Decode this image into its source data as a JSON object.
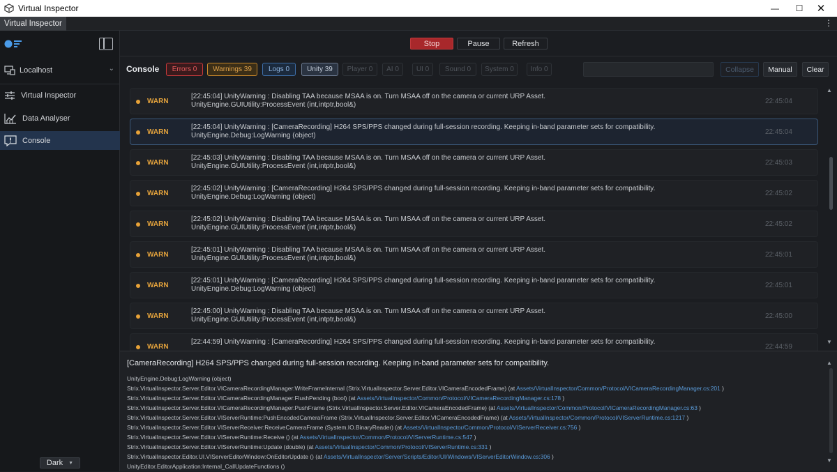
{
  "window": {
    "title": "Virtual Inspector"
  },
  "tab": {
    "label": "Virtual Inspector"
  },
  "sidebar": {
    "host": "Localhost",
    "items": [
      {
        "label": "Virtual Inspector",
        "icon": "sliders-icon"
      },
      {
        "label": "Data Analyser",
        "icon": "line-chart-icon"
      },
      {
        "label": "Console",
        "icon": "console-alert-icon",
        "active": true
      }
    ],
    "theme": "Dark"
  },
  "toolbar": {
    "stop": "Stop",
    "pause": "Pause",
    "refresh": "Refresh"
  },
  "console": {
    "title": "Console",
    "filters": [
      {
        "label": "Errors 0",
        "state": "errors"
      },
      {
        "label": "Warnings 39",
        "state": "warn"
      },
      {
        "label": "Logs 0",
        "state": "logs"
      },
      {
        "label": "Unity 39",
        "state": "unity"
      },
      {
        "label": "Player 0",
        "state": "off"
      },
      {
        "label": "AI 0",
        "state": "off"
      },
      {
        "label": "UI 0",
        "state": "off"
      },
      {
        "label": "Sound 0",
        "state": "off"
      },
      {
        "label": "System 0",
        "state": "off"
      },
      {
        "label": "Info 0",
        "state": "off"
      }
    ],
    "search_value": "",
    "collapse": "Collapse",
    "manual": "Manual",
    "clear": "Clear"
  },
  "colors": {
    "warn": "#e8a237",
    "stop": "#a8282b",
    "link": "#5a9bd9",
    "selected_border": "#3a5778"
  },
  "logs": [
    {
      "level": "WARN",
      "line1": "[22:45:04] UnityWarning : Disabling TAA because MSAA is on. Turn MSAA off on the camera or current URP Asset.",
      "line2": "UnityEngine.GUIUtility:ProcessEvent (int,intptr,bool&)",
      "time": "22:45:04",
      "selected": false
    },
    {
      "level": "WARN",
      "line1": "[22:45:04] UnityWarning : [CameraRecording] H264 SPS/PPS changed during full-session recording. Keeping in-band parameter sets for compatibility.",
      "line2": "UnityEngine.Debug:LogWarning (object)",
      "time": "22:45:04",
      "selected": true
    },
    {
      "level": "WARN",
      "line1": "[22:45:03] UnityWarning : Disabling TAA because MSAA is on. Turn MSAA off on the camera or current URP Asset.",
      "line2": "UnityEngine.GUIUtility:ProcessEvent (int,intptr,bool&)",
      "time": "22:45:03",
      "selected": false
    },
    {
      "level": "WARN",
      "line1": "[22:45:02] UnityWarning : [CameraRecording] H264 SPS/PPS changed during full-session recording. Keeping in-band parameter sets for compatibility.",
      "line2": "UnityEngine.Debug:LogWarning (object)",
      "time": "22:45:02",
      "selected": false
    },
    {
      "level": "WARN",
      "line1": "[22:45:02] UnityWarning : Disabling TAA because MSAA is on. Turn MSAA off on the camera or current URP Asset.",
      "line2": "UnityEngine.GUIUtility:ProcessEvent (int,intptr,bool&)",
      "time": "22:45:02",
      "selected": false
    },
    {
      "level": "WARN",
      "line1": "[22:45:01] UnityWarning : Disabling TAA because MSAA is on. Turn MSAA off on the camera or current URP Asset.",
      "line2": "UnityEngine.GUIUtility:ProcessEvent (int,intptr,bool&)",
      "time": "22:45:01",
      "selected": false
    },
    {
      "level": "WARN",
      "line1": "[22:45:01] UnityWarning : [CameraRecording] H264 SPS/PPS changed during full-session recording. Keeping in-band parameter sets for compatibility.",
      "line2": "UnityEngine.Debug:LogWarning (object)",
      "time": "22:45:01",
      "selected": false
    },
    {
      "level": "WARN",
      "line1": "[22:45:00] UnityWarning : Disabling TAA because MSAA is on. Turn MSAA off on the camera or current URP Asset.",
      "line2": "UnityEngine.GUIUtility:ProcessEvent (int,intptr,bool&)",
      "time": "22:45:00",
      "selected": false
    },
    {
      "level": "WARN",
      "line1": "[22:44:59] UnityWarning : [CameraRecording] H264 SPS/PPS changed during full-session recording. Keeping in-band parameter sets for compatibility.",
      "line2": "",
      "time": "22:44:59",
      "selected": false
    }
  ],
  "detail": {
    "headline": "[CameraRecording] H264 SPS/PPS changed during full-session recording. Keeping in-band parameter sets for compatibility.",
    "stack": [
      {
        "text": "UnityEngine.Debug:LogWarning (object)",
        "link": ""
      },
      {
        "text": "Strix.VirtualInspector.Server.Editor.VICameraRecordingManager:WriteFrameInternal (Strix.VirtualInspector.Server.Editor.VICameraEncodedFrame) (at ",
        "link": "Assets/VirtualInspector/Common/Protocol/VICameraRecordingManager.cs:201",
        "tail": " )"
      },
      {
        "text": "Strix.VirtualInspector.Server.Editor.VICameraRecordingManager:FlushPending (bool) (at ",
        "link": "Assets/VirtualInspector/Common/Protocol/VICameraRecordingManager.cs:178",
        "tail": " )"
      },
      {
        "text": "Strix.VirtualInspector.Server.Editor.VICameraRecordingManager:PushFrame (Strix.VirtualInspector.Server.Editor.VICameraEncodedFrame) (at ",
        "link": "Assets/VirtualInspector/Common/Protocol/VICameraRecordingManager.cs:63",
        "tail": " )"
      },
      {
        "text": "Strix.VirtualInspector.Server.Editor.VIServerRuntime:PushEncodedCameraFrame (Strix.VirtualInspector.Server.Editor.VICameraEncodedFrame) (at ",
        "link": "Assets/VirtualInspector/Common/Protocol/VIServerRuntime.cs:1217",
        "tail": " )"
      },
      {
        "text": "Strix.VirtualInspector.Server.Editor.VIServerReceiver:ReceiveCameraFrame (System.IO.BinaryReader) (at ",
        "link": "Assets/VirtualInspector/Common/Protocol/VIServerReceiver.cs:756",
        "tail": " )"
      },
      {
        "text": "Strix.VirtualInspector.Server.Editor.VIServerRuntime:Receive () (at ",
        "link": "Assets/VirtualInspector/Common/Protocol/VIServerRuntime.cs:547",
        "tail": " )"
      },
      {
        "text": "Strix.VirtualInspector.Server.Editor.VIServerRuntime:Update (double) (at ",
        "link": "Assets/VirtualInspector/Common/Protocol/VIServerRuntime.cs:331",
        "tail": " )"
      },
      {
        "text": "Strix.VirtualInspector.Editor.UI.VIServerEditorWindow:OnEditorUpdate () (at ",
        "link": "Assets/VirtualInspector/Server/Scripts/Editor/UI/Windows/VIServerEditorWindow.cs:306",
        "tail": " )"
      },
      {
        "text": "UnityEditor.EditorApplication:Internal_CallUpdateFunctions ()",
        "link": ""
      }
    ]
  }
}
